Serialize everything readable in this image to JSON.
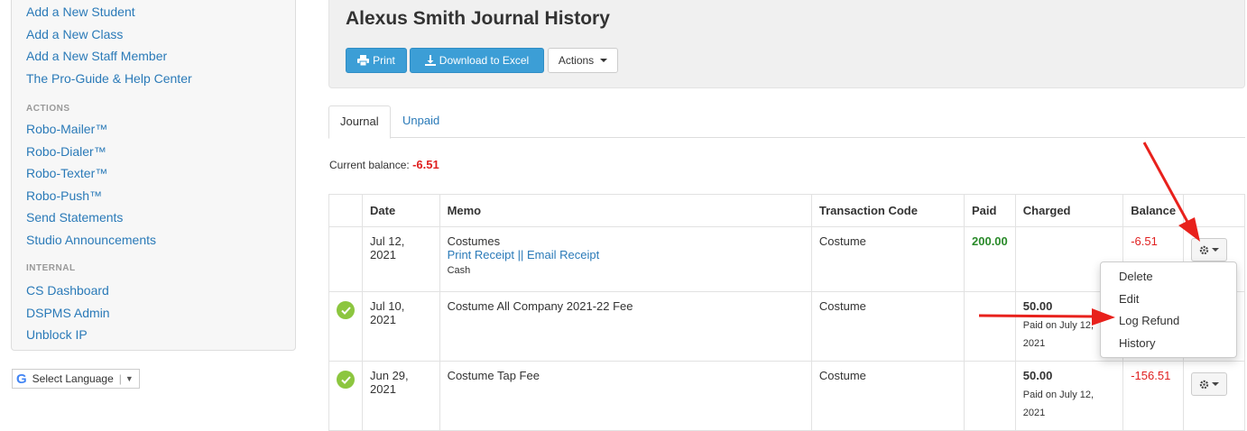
{
  "sidebar": {
    "top_links": [
      "Add a New Student",
      "Add a New Class",
      "Add a New Staff Member",
      "The Pro-Guide & Help Center"
    ],
    "actions_heading": "ACTIONS",
    "actions": [
      "Robo-Mailer™",
      "Robo-Dialer™",
      "Robo-Texter™",
      "Robo-Push™",
      "Send Statements",
      "Studio Announcements"
    ],
    "internal_heading": "INTERNAL",
    "internal": [
      "CS Dashboard",
      "DSPMS Admin",
      "Unblock IP"
    ]
  },
  "language": {
    "logo": "G",
    "label": "Select Language",
    "separator": "|",
    "arrow": "▼"
  },
  "header": {
    "title": "Alexus Smith Journal History",
    "print_label": "Print",
    "excel_label": "Download to Excel",
    "actions_label": "Actions"
  },
  "tabs": {
    "journal": "Journal",
    "unpaid": "Unpaid"
  },
  "balance": {
    "label": "Current balance:",
    "value": "-6.51"
  },
  "table": {
    "headers": {
      "date": "Date",
      "memo": "Memo",
      "code": "Transaction Code",
      "paid": "Paid",
      "charged": "Charged",
      "balance": "Balance"
    },
    "rows": [
      {
        "date": "Jul 12, 2021",
        "memo": "Costumes",
        "print_receipt": "Print Receipt",
        "link_sep": "||",
        "email_receipt": "Email Receipt",
        "method": "Cash",
        "code": "Costume",
        "paid": "200.00",
        "charged": "",
        "charged_note": "",
        "balance": "-6.51"
      },
      {
        "date": "Jul 10, 2021",
        "memo": "Costume All Company 2021-22 Fee",
        "code": "Costume",
        "paid": "",
        "charged": "50.00",
        "charged_note": "Paid on July 12, 2021",
        "balance": ""
      },
      {
        "date": "Jun 29, 2021",
        "memo": "Costume Tap Fee",
        "code": "Costume",
        "paid": "",
        "charged": "50.00",
        "charged_note": "Paid on July 12, 2021",
        "balance": "-156.51"
      }
    ]
  },
  "dropdown": {
    "items": [
      "Delete",
      "Edit",
      "Log Refund",
      "History"
    ]
  },
  "icons": {
    "print": "print-icon",
    "download": "download-icon",
    "gear": "gear-icon",
    "check": "check-circle-icon"
  },
  "colors": {
    "accent": "#3c9ed6",
    "link": "#2a7ab8",
    "negative": "#e02020",
    "positive": "#2a8a2a",
    "check": "#8cc63f",
    "arrow": "#e8211c"
  }
}
